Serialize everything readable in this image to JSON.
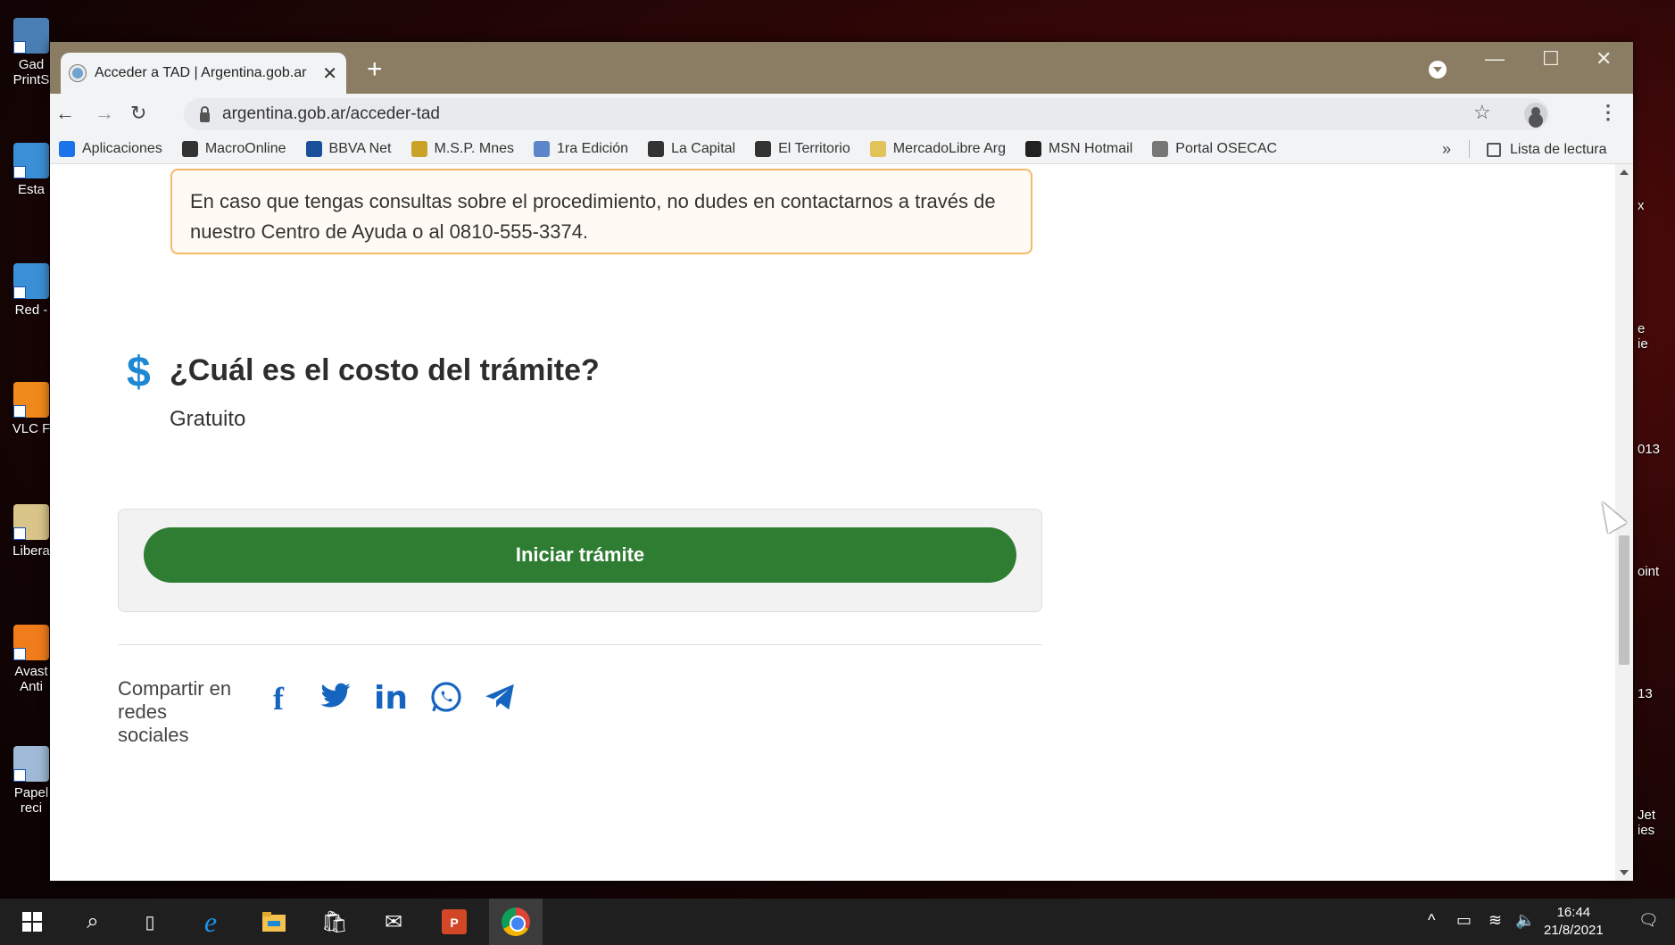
{
  "desktop": {
    "icons_left": [
      {
        "label": "Gad\nPrintS",
        "color": "#4a7fb5"
      },
      {
        "label": "Esta",
        "color": "#3b8fd6"
      },
      {
        "label": "Red -",
        "color": "#3b8fd6"
      },
      {
        "label": "VLC F",
        "color": "#f08a1c"
      },
      {
        "label": "Libera",
        "color": "#d9c48a"
      },
      {
        "label": "Avast\nAnti",
        "color": "#f07c1c"
      },
      {
        "label": "Papel\nreci",
        "color": "#9fb9d6"
      }
    ],
    "icons_right": [
      "x",
      "e\nie",
      "013",
      "oint",
      "13",
      "Jet\nies"
    ]
  },
  "browser": {
    "tab_title": "Acceder a TAD | Argentina.gob.ar",
    "url": "argentina.gob.ar/acceder-tad",
    "bookmarks": [
      {
        "label": "Aplicaciones",
        "color": "#1a73e8"
      },
      {
        "label": "MacroOnline",
        "color": "#333333"
      },
      {
        "label": "BBVA Net",
        "color": "#1a4f9c"
      },
      {
        "label": "M.S.P. Mnes",
        "color": "#c9a227"
      },
      {
        "label": "1ra Edición",
        "color": "#5b86c9"
      },
      {
        "label": "La Capital",
        "color": "#333333"
      },
      {
        "label": "El Territorio",
        "color": "#333333"
      },
      {
        "label": "MercadoLibre Arg",
        "color": "#e2c35a"
      },
      {
        "label": "MSN Hotmail",
        "color": "#222222"
      },
      {
        "label": "Portal OSECAC",
        "color": "#777777"
      }
    ],
    "more_bookmarks": "»",
    "reading_list": "Lista de lectura"
  },
  "page": {
    "alert_text": "En caso que tengas consultas sobre el procedimiento, no dudes en contactarnos a través de nuestro Centro de Ayuda o al 0810-555-3374.",
    "cost_icon": "$",
    "cost_heading": "¿Cuál es el costo del trámite?",
    "cost_value": "Gratuito",
    "start_button": "Iniciar trámite",
    "share_label": "Compartir en redes sociales",
    "social": [
      "facebook-icon",
      "twitter-icon",
      "linkedin-icon",
      "whatsapp-icon",
      "telegram-icon"
    ]
  },
  "taskbar": {
    "time": "16:44",
    "date": "21/8/2021"
  },
  "colors": {
    "primary_button": "#2e7d32",
    "alert_border": "#f2b86b",
    "accent_blue": "#1e88d4",
    "social_blue": "#1565c0"
  }
}
